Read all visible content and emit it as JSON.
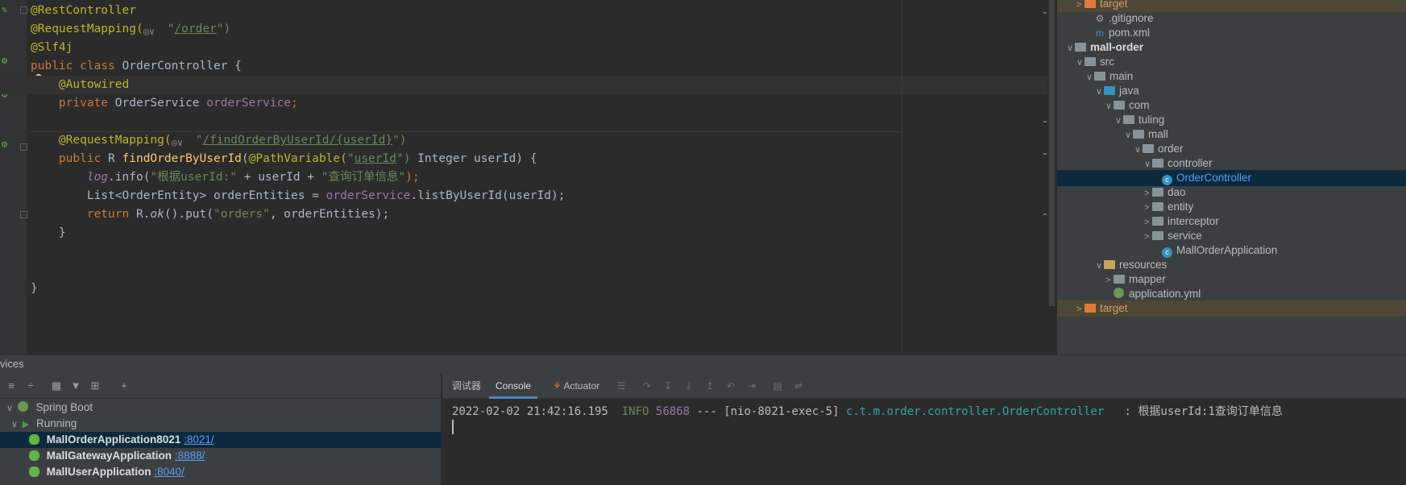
{
  "editor": {
    "lines": [
      {
        "parts": [
          {
            "t": "@RestController",
            "c": "ann"
          }
        ]
      },
      {
        "parts": [
          {
            "t": "@RequestMapping(",
            "c": "ann"
          },
          {
            "t": "GLOBE"
          },
          {
            "t": "\"",
            "c": "str"
          },
          {
            "t": "/order",
            "c": "strl"
          },
          {
            "t": "\")",
            "c": "str"
          }
        ]
      },
      {
        "parts": [
          {
            "t": "@Slf4j",
            "c": "ann"
          }
        ]
      },
      {
        "parts": [
          {
            "t": "public class ",
            "c": "kw"
          },
          {
            "t": "OrderController {",
            "c": ""
          }
        ]
      },
      {
        "parts": [
          {
            "t": "    "
          },
          {
            "t": "@Autowired",
            "c": "ann"
          }
        ],
        "caret": true
      },
      {
        "parts": [
          {
            "t": "    private ",
            "c": "kw"
          },
          {
            "t": "OrderService ",
            "c": ""
          },
          {
            "t": "orderService",
            "c": "fld"
          },
          {
            "t": ";",
            "c": "kw"
          }
        ]
      },
      {
        "parts": [
          {
            "t": ""
          }
        ]
      },
      {
        "parts": [
          {
            "t": "    @RequestMapping(",
            "c": "ann"
          },
          {
            "t": "GLOBE"
          },
          {
            "t": "\"",
            "c": "str"
          },
          {
            "t": "/findOrderByUserId/{userId}",
            "c": "strl"
          },
          {
            "t": "\")",
            "c": "str"
          }
        ]
      },
      {
        "parts": [
          {
            "t": "    public ",
            "c": "kw"
          },
          {
            "t": "R ",
            "c": ""
          },
          {
            "t": "findOrderByUserId",
            "c": "fn"
          },
          {
            "t": "(",
            "c": ""
          },
          {
            "t": "@PathVariable(",
            "c": "ann"
          },
          {
            "t": "\"",
            "c": "str"
          },
          {
            "t": "userId",
            "c": "strl"
          },
          {
            "t": "\")",
            "c": "str"
          },
          {
            "t": " Integer userId) {",
            "c": ""
          }
        ]
      },
      {
        "parts": [
          {
            "t": "        "
          },
          {
            "t": "log",
            "c": "logv"
          },
          {
            "t": ".info(",
            "c": ""
          },
          {
            "t": "\"根据userId:\"",
            "c": "str"
          },
          {
            "t": " + userId + ",
            "c": ""
          },
          {
            "t": "\"查询订单信息\"",
            "c": "str"
          },
          {
            "t": ");",
            "c": "kw"
          }
        ]
      },
      {
        "parts": [
          {
            "t": "        List<OrderEntity> orderEntities = ",
            "c": ""
          },
          {
            "t": "orderService",
            "c": "fld"
          },
          {
            "t": ".listByUserId(userId);",
            "c": ""
          }
        ]
      },
      {
        "parts": [
          {
            "t": "        return ",
            "c": "kw"
          },
          {
            "t": "R.",
            "c": ""
          },
          {
            "t": "ok",
            "c": "it"
          },
          {
            "t": "().put(",
            "c": ""
          },
          {
            "t": "\"orders\"",
            "c": "str"
          },
          {
            "t": ", orderEntities);",
            "c": ""
          }
        ]
      },
      {
        "parts": [
          {
            "t": "    }",
            "c": ""
          }
        ]
      },
      {
        "parts": [
          {
            "t": ""
          }
        ]
      },
      {
        "parts": [
          {
            "t": ""
          }
        ]
      },
      {
        "parts": [
          {
            "t": "}",
            "c": ""
          }
        ]
      }
    ]
  },
  "tree": {
    "items": [
      {
        "label": "target",
        "indent": 1,
        "arrow": ">",
        "icon": "excl",
        "style": "excl",
        "row": "hl"
      },
      {
        "label": ".gitignore",
        "indent": 2,
        "arrow": "",
        "icon": "file",
        "glyph": "⚙"
      },
      {
        "label": "pom.xml",
        "indent": 2,
        "arrow": "",
        "icon": "file",
        "glyph": "m"
      },
      {
        "label": "mall-order",
        "indent": 0,
        "arrow": "∨",
        "icon": "pkg",
        "style": "bold"
      },
      {
        "label": "src",
        "indent": 1,
        "arrow": "∨",
        "icon": "pkg"
      },
      {
        "label": "main",
        "indent": 2,
        "arrow": "∨",
        "icon": "pkg"
      },
      {
        "label": "java",
        "indent": 3,
        "arrow": "∨",
        "icon": "src"
      },
      {
        "label": "com",
        "indent": 4,
        "arrow": "∨",
        "icon": "pkg"
      },
      {
        "label": "tuling",
        "indent": 5,
        "arrow": "∨",
        "icon": "pkg"
      },
      {
        "label": "mall",
        "indent": 6,
        "arrow": "∨",
        "icon": "pkg"
      },
      {
        "label": "order",
        "indent": 7,
        "arrow": "∨",
        "icon": "pkg"
      },
      {
        "label": "controller",
        "indent": 8,
        "arrow": "∨",
        "icon": "pkg"
      },
      {
        "label": "OrderController",
        "indent": 9,
        "arrow": "",
        "icon": "class",
        "style": "sel",
        "row": "sel"
      },
      {
        "label": "dao",
        "indent": 8,
        "arrow": ">",
        "icon": "pkg"
      },
      {
        "label": "entity",
        "indent": 8,
        "arrow": ">",
        "icon": "pkg"
      },
      {
        "label": "interceptor",
        "indent": 8,
        "arrow": ">",
        "icon": "pkg"
      },
      {
        "label": "service",
        "indent": 8,
        "arrow": ">",
        "icon": "pkg"
      },
      {
        "label": "MallOrderApplication",
        "indent": 9,
        "arrow": "",
        "icon": "class"
      },
      {
        "label": "resources",
        "indent": 3,
        "arrow": "∨",
        "icon": "res"
      },
      {
        "label": "mapper",
        "indent": 4,
        "arrow": ">",
        "icon": "pkg"
      },
      {
        "label": "application.yml",
        "indent": 4,
        "arrow": "",
        "icon": "spring"
      },
      {
        "label": "target",
        "indent": 1,
        "arrow": ">",
        "icon": "excl",
        "style": "excl",
        "row": "hl"
      }
    ]
  },
  "panel": {
    "title": "vices"
  },
  "services": {
    "spring_boot": "Spring Boot",
    "running": "Running",
    "apps": [
      {
        "name": "MallOrderApplication8021",
        "port": ":8021/",
        "selected": true
      },
      {
        "name": "MallGatewayApplication",
        "port": ":8888/"
      },
      {
        "name": "MallUserApplication",
        "port": ":8040/"
      }
    ]
  },
  "console": {
    "tabs": {
      "debugger": "调试器",
      "console": "Console",
      "actuator": "Actuator"
    },
    "log": {
      "timestamp": "2022-02-02 21:42:16.195",
      "level": "INFO",
      "pid": "56868",
      "dashes": "---",
      "thread": "[nio-8021-exec-5]",
      "logger": "c.t.m.order.controller.OrderController",
      "message": ": 根据userId:1查询订单信息"
    }
  }
}
